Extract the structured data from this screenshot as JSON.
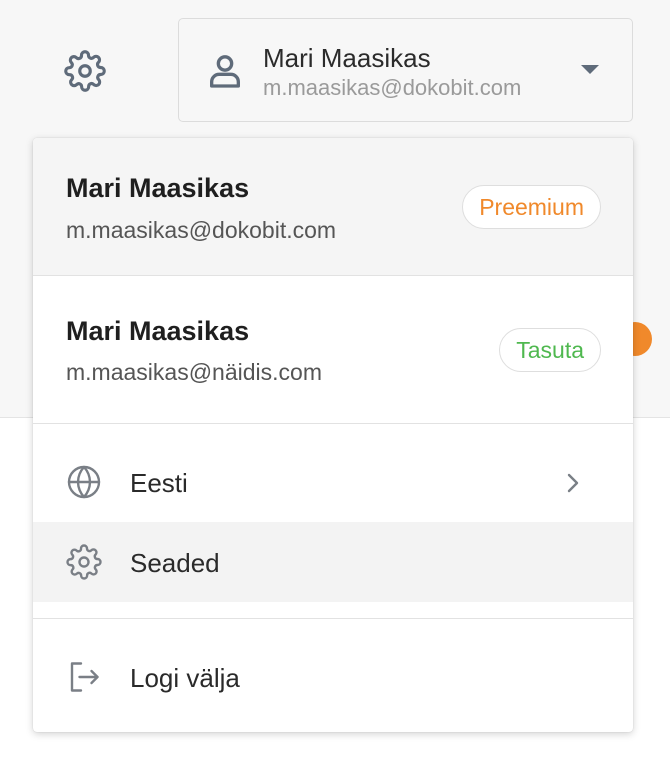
{
  "header": {
    "selector": {
      "name": "Mari Maasikas",
      "email": "m.maasikas@dokobit.com"
    }
  },
  "dropdown": {
    "accounts": [
      {
        "name": "Mari Maasikas",
        "email": "m.maasikas@dokobit.com",
        "plan": "Preemium",
        "plan_color": "#f0892b"
      },
      {
        "name": "Mari Maasikas",
        "email": "m.maasikas@näidis.com",
        "plan": "Tasuta",
        "plan_color": "#4fb84f"
      }
    ],
    "menu": {
      "language": {
        "label": "Eesti",
        "icon": "globe-icon"
      },
      "settings": {
        "label": "Seaded",
        "icon": "gear-icon"
      },
      "logout": {
        "label": "Logi välja",
        "icon": "logout-icon"
      }
    }
  },
  "colors": {
    "accent_orange": "#f0892b",
    "accent_green": "#4fb84f",
    "icon_gray": "#5f6b7a"
  }
}
